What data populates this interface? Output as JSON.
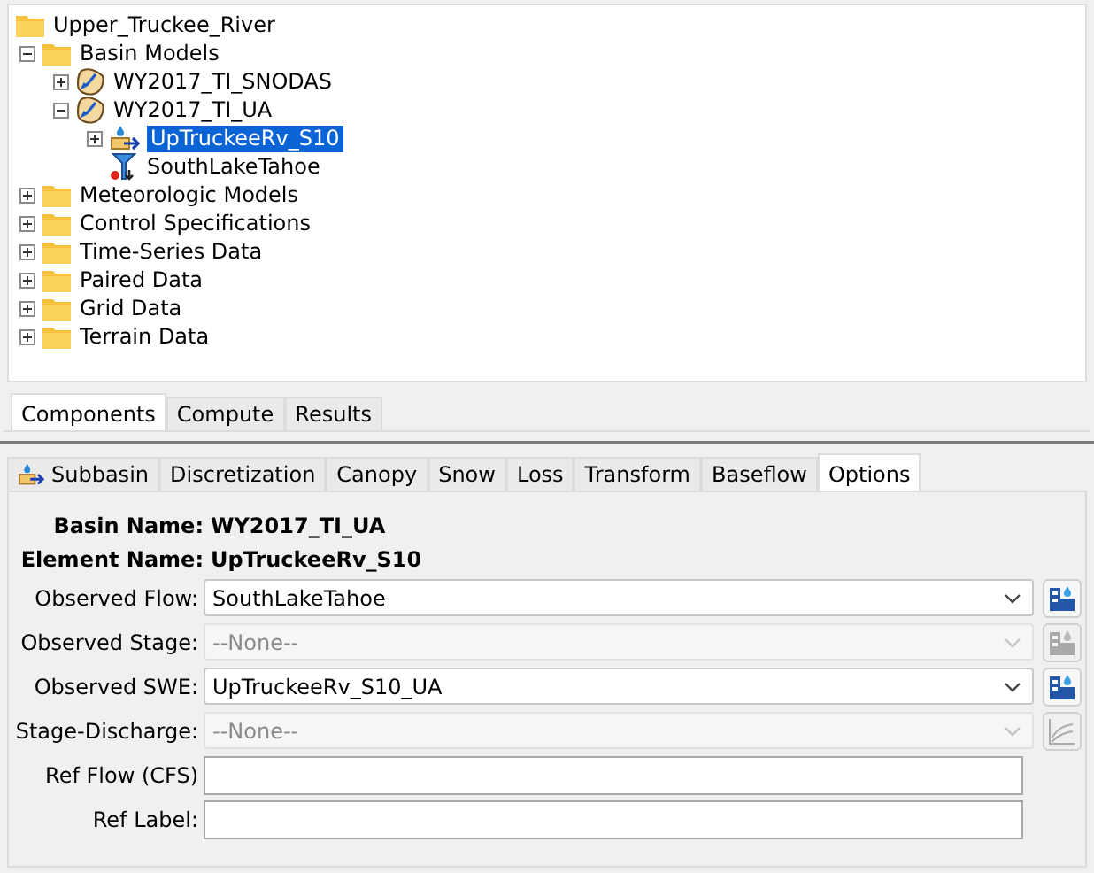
{
  "tree": [
    {
      "label": "Upper_Truckee_River",
      "kind": "folder",
      "selected": false,
      "children": [
        {
          "label": "Basin Models",
          "kind": "folder",
          "selected": false,
          "expanded": true,
          "children": [
            {
              "label": "WY2017_TI_SNODAS",
              "kind": "basin",
              "selected": false,
              "expanded": false
            },
            {
              "label": "WY2017_TI_UA",
              "kind": "basin",
              "selected": false,
              "expanded": true,
              "children": [
                {
                  "label": "UpTruckeeRv_S10",
                  "kind": "subbasin",
                  "selected": true,
                  "expanded": false
                },
                {
                  "label": "SouthLakeTahoe",
                  "kind": "sink",
                  "selected": false
                }
              ]
            }
          ]
        },
        {
          "label": "Meteorologic Models",
          "kind": "folder",
          "selected": false,
          "expanded": false
        },
        {
          "label": "Control Specifications",
          "kind": "folder",
          "selected": false,
          "expanded": false
        },
        {
          "label": "Time-Series Data",
          "kind": "folder",
          "selected": false,
          "expanded": false
        },
        {
          "label": "Paired Data",
          "kind": "folder",
          "selected": false,
          "expanded": false
        },
        {
          "label": "Grid Data",
          "kind": "folder",
          "selected": false,
          "expanded": false
        },
        {
          "label": "Terrain Data",
          "kind": "folder",
          "selected": false,
          "expanded": false
        }
      ]
    }
  ],
  "bottom_tabs": [
    {
      "label": "Components",
      "selected": true
    },
    {
      "label": "Compute",
      "selected": false
    },
    {
      "label": "Results",
      "selected": false
    }
  ],
  "editor_tabs": [
    {
      "label": "Subbasin",
      "selected": false,
      "icon": true
    },
    {
      "label": "Discretization",
      "selected": false
    },
    {
      "label": "Canopy",
      "selected": false
    },
    {
      "label": "Snow",
      "selected": false
    },
    {
      "label": "Loss",
      "selected": false
    },
    {
      "label": "Transform",
      "selected": false
    },
    {
      "label": "Baseflow",
      "selected": false
    },
    {
      "label": "Options",
      "selected": true
    }
  ],
  "header": [
    {
      "label": "Basin Name:",
      "value": "WY2017_TI_UA"
    },
    {
      "label": "Element Name:",
      "value": "UpTruckeeRv_S10"
    }
  ],
  "fields": [
    {
      "kind": "dropdown",
      "label": "Observed Flow:",
      "value": "SouthLakeTahoe",
      "disabled": false,
      "button": {
        "kind": "gage"
      }
    },
    {
      "kind": "dropdown",
      "label": "Observed Stage:",
      "value": "--None--",
      "disabled": true,
      "button": {
        "kind": "gage"
      }
    },
    {
      "kind": "dropdown",
      "label": "Observed SWE:",
      "value": "UpTruckeeRv_S10_UA",
      "disabled": false,
      "button": {
        "kind": "gage"
      }
    },
    {
      "kind": "dropdown",
      "label": "Stage-Discharge:",
      "value": "--None--",
      "disabled": true,
      "button": {
        "kind": "curve"
      }
    },
    {
      "kind": "text",
      "label": "Ref Flow (CFS)"
    },
    {
      "kind": "text",
      "label": "Ref Label:"
    }
  ]
}
